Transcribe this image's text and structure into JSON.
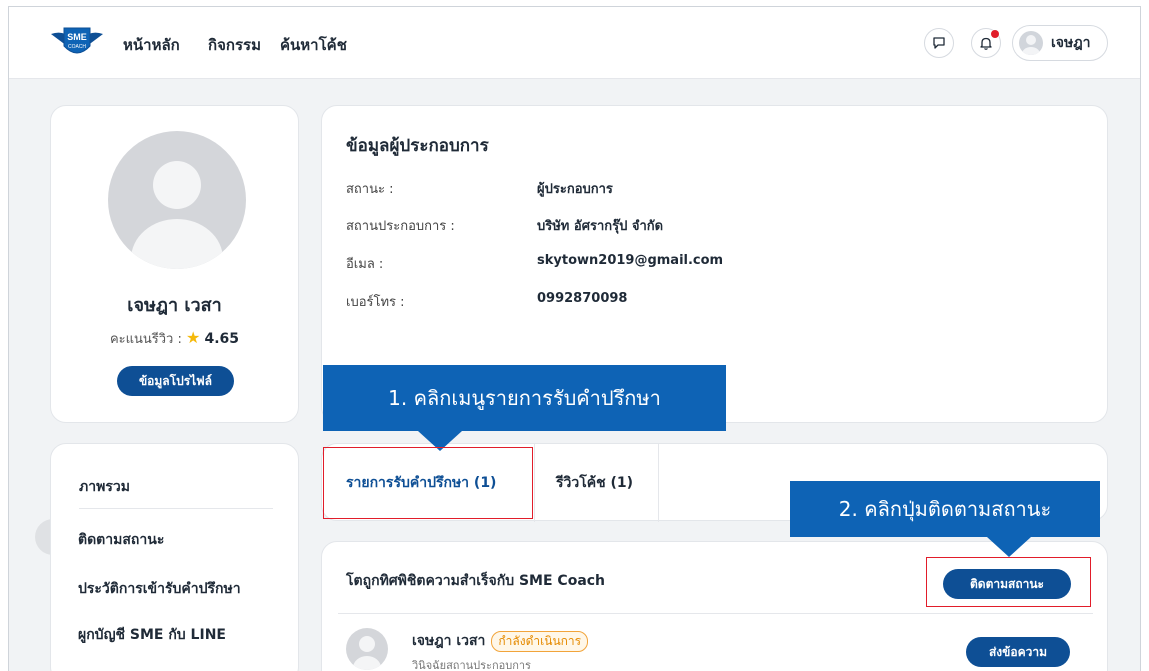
{
  "nav": {
    "links": [
      "หน้าหลัก",
      "กิจกรรม",
      "ค้นหาโค้ช"
    ],
    "logo_text": "SME COACH",
    "user_name": "เจษฎา"
  },
  "profile": {
    "name": "เจษฎา เวสา",
    "rating_label": "คะแนนรีวิว :",
    "rating_value": "4.65",
    "button": "ข้อมูลโปรไฟล์"
  },
  "info": {
    "title": "ข้อมูลผู้ประกอบการ",
    "rows": [
      {
        "label": "สถานะ :",
        "value": "ผู้ประกอบการ"
      },
      {
        "label": "สถานประกอบการ :",
        "value": "บริษัท อัศรากรุ๊ป จำกัด"
      },
      {
        "label": "อีเมล :",
        "value": "skytown2019@gmail.com"
      },
      {
        "label": "เบอร์โทร :",
        "value": "0992870098"
      }
    ]
  },
  "menu": {
    "items": [
      "ภาพรวม",
      "ติดตามสถานะ",
      "ประวัติการเข้ารับคำปรึกษา",
      "ผูกบัญชี SME กับ LINE"
    ],
    "active_index": 1
  },
  "tabs": [
    {
      "label": "รายการรับคำปรึกษา (1)",
      "active": true
    },
    {
      "label": "รีวิวโค้ช (1)",
      "active": false
    }
  ],
  "consult": {
    "title": "โตถูกทิศพิชิตความสำเร็จกับ SME Coach",
    "track_button": "ติดตามสถานะ",
    "coach_name": "เจษฎา เวสา",
    "status": "กำลังดำเนินการ",
    "subtitle": "วินิจฉัยสถานประกอบการ",
    "message_button": "ส่งข้อความ"
  },
  "annotations": {
    "step1": "1. คลิกเมนูรายการรับคำปรึกษา",
    "step2": "2. คลิกปุ่มติดตามสถานะ"
  },
  "colors": {
    "primary": "#0e4f95",
    "callout": "#0e63b5",
    "highlight": "#e11d2a",
    "status": "#e58a00",
    "star": "#f5b90a"
  }
}
